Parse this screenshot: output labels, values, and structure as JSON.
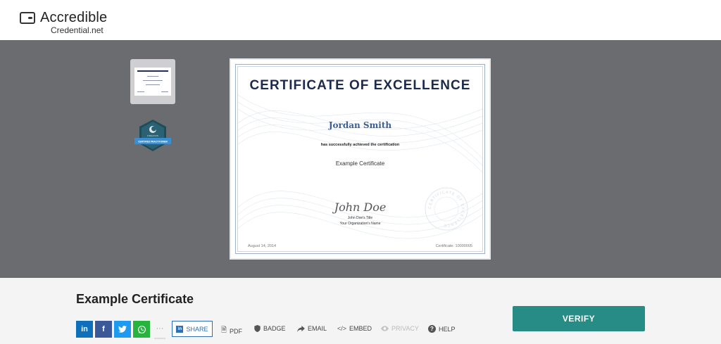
{
  "header": {
    "brand": "Accredible",
    "domain": "Credential.net"
  },
  "certificate": {
    "title": "CERTIFICATE OF EXCELLENCE",
    "recipient": "Jordan Smith",
    "achievement_text": "has successfully achieved the certification",
    "name": "Example Certificate",
    "signature": "John Doe",
    "signer_title": "John Doe's Title",
    "signer_org": "Your Organization's Name",
    "date": "August 14, 2014",
    "number": "Certificate: 10000005",
    "seal_text": "CERTIFICATE OF EXCELLENCE"
  },
  "thumbnails": {
    "badge_label_top": "FIDELIOUS",
    "badge_label": "CERTIFIED PRACTITIONER"
  },
  "details": {
    "title": "Example Certificate"
  },
  "social": {
    "linkedin": "in",
    "facebook": "f",
    "twitter": "t",
    "whatsapp": "w",
    "more": "···",
    "colors": {
      "linkedin": "#0e6fba",
      "facebook": "#3b5998",
      "twitter": "#1d9bf0",
      "whatsapp": "#27b43e"
    }
  },
  "actions": {
    "share": "SHARE",
    "pdf": "PDF",
    "badge": "BADGE",
    "email": "EMAIL",
    "embed": "EMBED",
    "privacy": "PRIVACY",
    "help": "HELP"
  },
  "verify": {
    "label": "VERIFY",
    "color": "#268c85"
  }
}
